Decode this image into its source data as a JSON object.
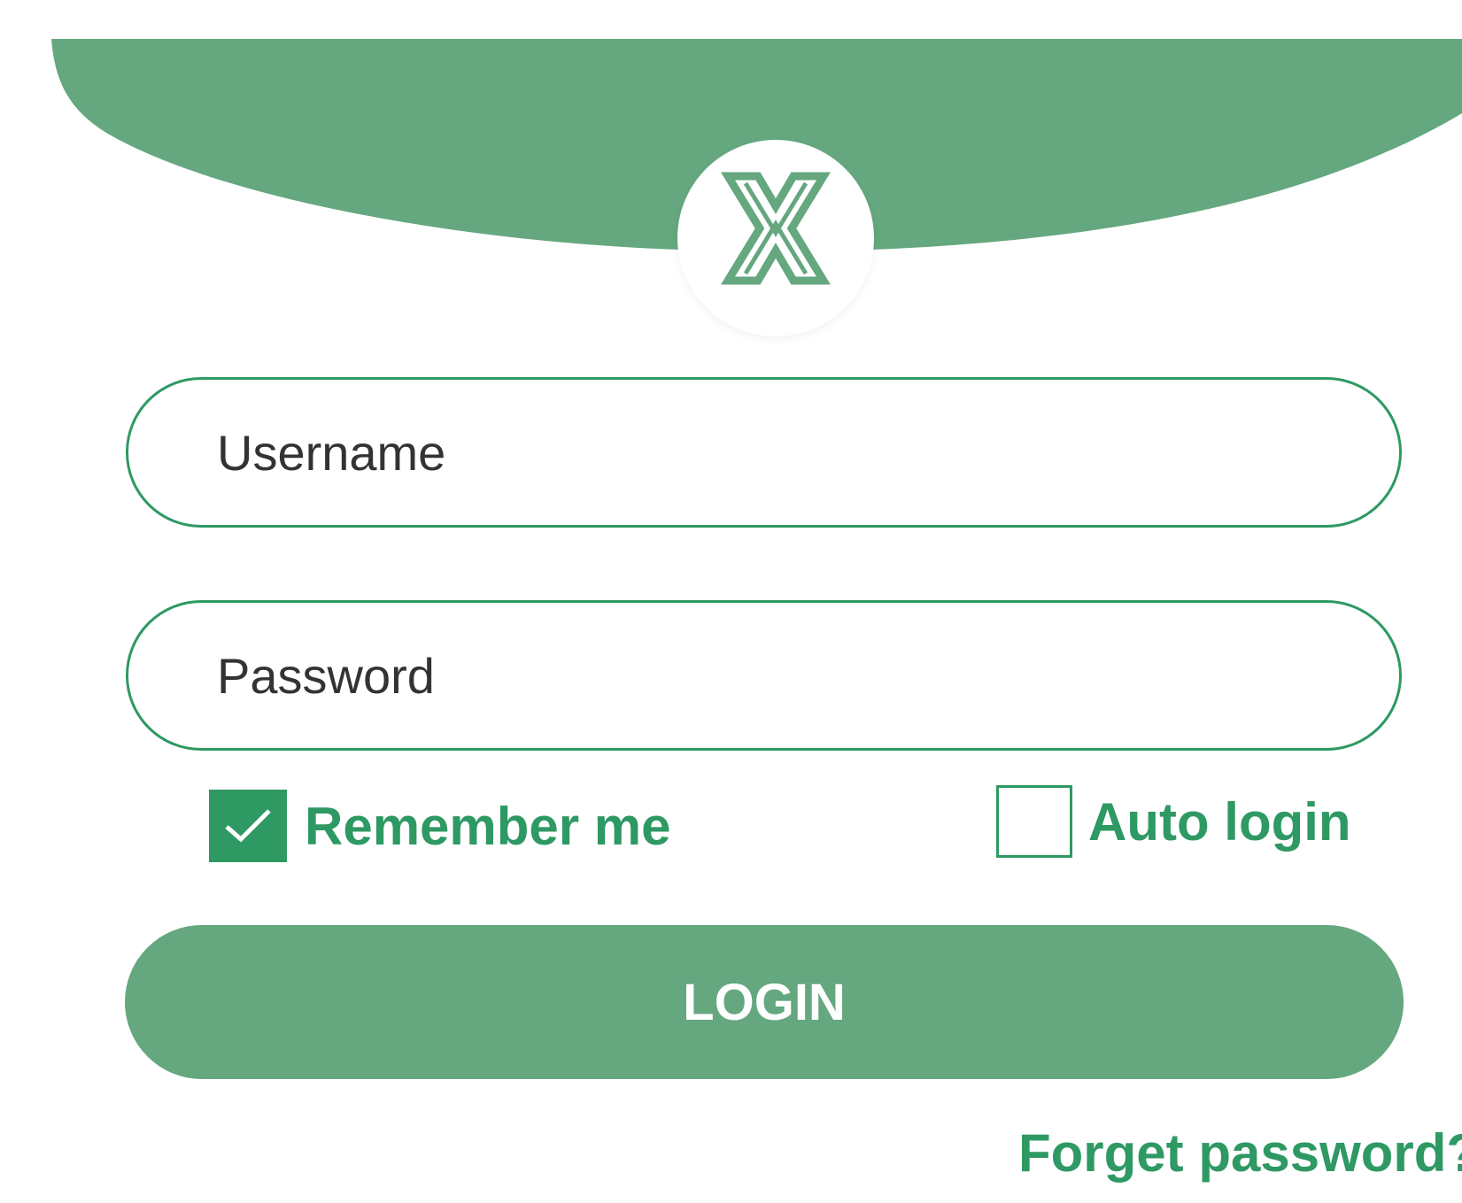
{
  "colors": {
    "brand_green": "#65a77f",
    "accent_green": "#2e9963",
    "background": "#ffffff",
    "input_text": "#333333"
  },
  "header": {
    "logo_icon": "x-logo-icon"
  },
  "form": {
    "username_placeholder": "Username",
    "password_placeholder": "Password",
    "remember_me": {
      "label": "Remember me",
      "checked": true
    },
    "auto_login": {
      "label": "Auto login",
      "checked": false
    },
    "login_label": "LOGIN",
    "forget_password_label": "Forget password?"
  }
}
